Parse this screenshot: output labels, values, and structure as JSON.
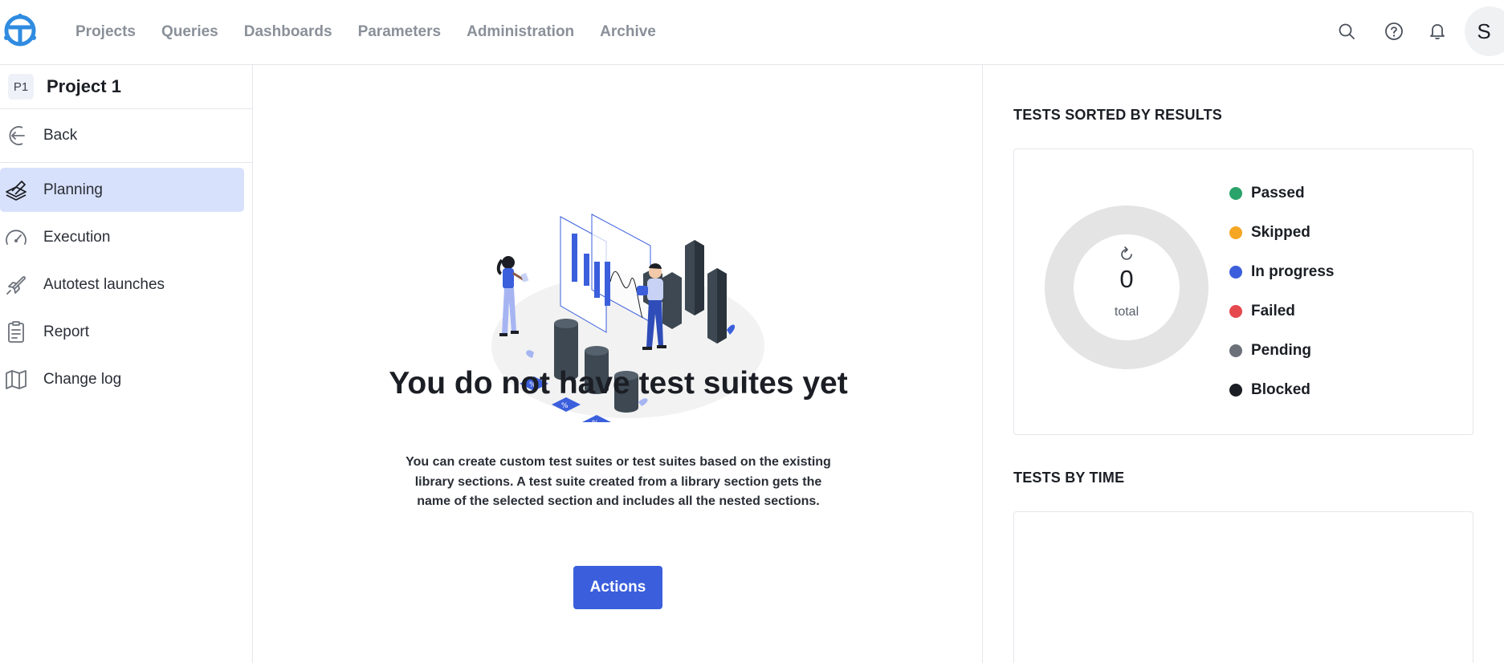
{
  "nav": {
    "items": [
      {
        "label": "Projects"
      },
      {
        "label": "Queries"
      },
      {
        "label": "Dashboards"
      },
      {
        "label": "Parameters"
      },
      {
        "label": "Administration"
      },
      {
        "label": "Archive"
      }
    ],
    "avatar_letter": "S"
  },
  "sidebar": {
    "project_badge": "P1",
    "project_name": "Project 1",
    "back_label": "Back",
    "items": [
      {
        "label": "Planning",
        "icon": "planning-icon",
        "active": true
      },
      {
        "label": "Execution",
        "icon": "speedometer-icon"
      },
      {
        "label": "Autotest launches",
        "icon": "rocket-icon"
      },
      {
        "label": "Report",
        "icon": "clipboard-icon"
      },
      {
        "label": "Change log",
        "icon": "map-icon"
      }
    ]
  },
  "main": {
    "empty_title": "You do not have test suites yet",
    "empty_description": "You can create custom test suites or test suites based on the existing library sections. A test suite created from a library section gets the name of the selected section and includes all the nested sections.",
    "actions_label": "Actions"
  },
  "right": {
    "results_title": "TESTS SORTED BY RESULTS",
    "total_value": "0",
    "total_label": "total",
    "legend": [
      {
        "label": "Passed",
        "color": "#2aa36b"
      },
      {
        "label": "Skipped",
        "color": "#f5a623"
      },
      {
        "label": "In progress",
        "color": "#3b5fdc"
      },
      {
        "label": "Failed",
        "color": "#e5484d"
      },
      {
        "label": "Pending",
        "color": "#6b7079"
      },
      {
        "label": "Blocked",
        "color": "#1b1e24"
      }
    ],
    "time_title": "TESTS BY TIME"
  },
  "colors": {
    "accent": "#3b5fdc",
    "active_bg": "#d8e1fb",
    "logo": "#2f8be0"
  }
}
